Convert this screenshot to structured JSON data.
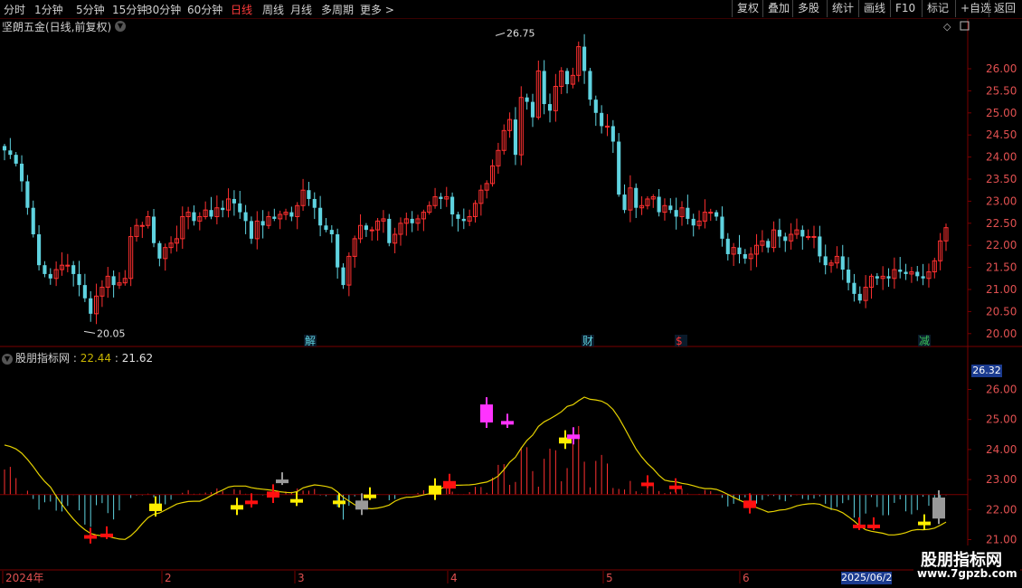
{
  "toolbar": {
    "periods": [
      "分时",
      "1分钟",
      "5分钟",
      "15分钟",
      "30分钟",
      "60分钟",
      "日线",
      "周线",
      "月线",
      "多周期",
      "更多 >"
    ],
    "active_period": "日线",
    "right_buttons": [
      "复权",
      "叠加",
      "多股",
      "统计",
      "画线",
      "F10",
      "标记",
      "+自选",
      "返回"
    ]
  },
  "main_chart": {
    "title": "坚朗五金(日线,前复权)",
    "high_label": "26.75",
    "low_label": "20.05",
    "y_ticks": [
      "26.00",
      "25.50",
      "25.00",
      "24.50",
      "24.00",
      "23.50",
      "23.00",
      "22.50",
      "22.00",
      "21.50",
      "21.00",
      "20.50",
      "20.00"
    ],
    "event_markers": [
      {
        "text": "解",
        "color": "#5fd3e0"
      },
      {
        "text": "财",
        "color": "#5fd3e0"
      },
      {
        "text": "$",
        "color": "#ff3030"
      },
      {
        "text": "减",
        "color": "#39c25a"
      }
    ]
  },
  "indicator": {
    "name": "股朋指标网",
    "value1": "22.44",
    "value2": "21.62",
    "y_ticks": [
      "26.00",
      "25.00",
      "24.00",
      "23.00",
      "22.00",
      "21.00"
    ],
    "last_badge": "26.32"
  },
  "x_axis": {
    "labels": [
      "2024年",
      "2",
      "3",
      "4",
      "5",
      "6"
    ],
    "cursor_date": "2025/06/2"
  },
  "watermark": {
    "line1": "股朋指标网",
    "line2": "www.7gpzb.com"
  },
  "colors": {
    "up": "#ff3030",
    "down": "#5fd3e0",
    "accent_red": "#ff3b3b",
    "yellow": "#ffee00",
    "magenta": "#ff33ff",
    "badge_blue": "#1b3b8f"
  },
  "chart_data": {
    "type": "candlestick",
    "symbol": "坚朗五金",
    "ylim": [
      20.0,
      26.9
    ],
    "high": 26.75,
    "low": 20.05,
    "closes": [
      24.15,
      24.05,
      23.85,
      23.45,
      22.85,
      22.25,
      21.55,
      21.35,
      21.25,
      21.45,
      21.55,
      21.55,
      21.35,
      21.1,
      20.8,
      20.45,
      20.85,
      21.05,
      21.3,
      21.1,
      21.15,
      21.25,
      22.2,
      22.45,
      22.45,
      22.65,
      22.05,
      21.7,
      21.95,
      22.05,
      22.15,
      22.65,
      22.75,
      22.55,
      22.65,
      22.8,
      22.65,
      22.85,
      22.8,
      23.05,
      22.95,
      22.75,
      22.55,
      22.15,
      22.55,
      22.45,
      22.65,
      22.6,
      22.7,
      22.75,
      22.65,
      22.9,
      23.25,
      23.05,
      22.85,
      22.45,
      22.35,
      22.25,
      21.5,
      21.1,
      21.75,
      22.15,
      22.45,
      22.35,
      22.35,
      22.55,
      22.6,
      22.05,
      22.25,
      22.5,
      22.6,
      22.5,
      22.6,
      22.75,
      22.9,
      23.1,
      23.05,
      23.1,
      22.7,
      22.6,
      22.55,
      22.65,
      22.95,
      23.25,
      23.4,
      23.8,
      24.15,
      24.6,
      24.85,
      24.05,
      25.35,
      25.25,
      24.9,
      25.95,
      25.2,
      25.05,
      25.6,
      25.95,
      25.65,
      25.85,
      26.5,
      25.95,
      25.3,
      25.0,
      24.7,
      24.7,
      24.35,
      23.15,
      22.8,
      23.3,
      22.85,
      22.9,
      23.05,
      23.1,
      22.75,
      22.9,
      22.8,
      22.65,
      22.85,
      22.6,
      22.45,
      22.55,
      22.75,
      22.75,
      22.65,
      22.15,
      21.8,
      21.95,
      21.8,
      21.7,
      21.8,
      22.0,
      22.1,
      21.95,
      22.35,
      22.2,
      22.1,
      22.25,
      22.35,
      22.2,
      22.2,
      22.2,
      21.75,
      21.55,
      21.6,
      21.75,
      21.45,
      21.15,
      20.9,
      20.75,
      21.05,
      21.3,
      21.25,
      21.3,
      21.25,
      21.45,
      21.4,
      21.35,
      21.4,
      21.3,
      21.25,
      21.4,
      21.65,
      22.1,
      22.4
    ]
  }
}
